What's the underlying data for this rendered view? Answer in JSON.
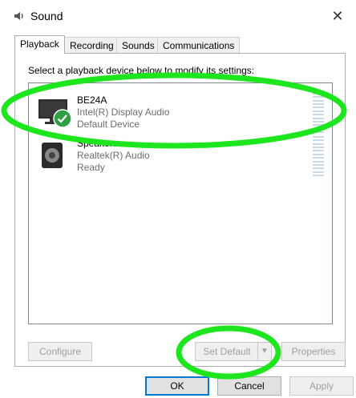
{
  "window": {
    "title": "Sound",
    "close_glyph": "✕",
    "icon": "speaker-icon"
  },
  "tabs": [
    {
      "label": "Playback",
      "active": true
    },
    {
      "label": "Recording",
      "active": false
    },
    {
      "label": "Sounds",
      "active": false
    },
    {
      "label": "Communications",
      "active": false
    }
  ],
  "instruction": "Select a playback device below to modify its settings:",
  "devices": [
    {
      "name": "BE24A",
      "driver": "Intel(R) Display Audio",
      "status": "Default Device",
      "icon": "monitor-icon",
      "badge": "check-badge-icon"
    },
    {
      "name": "Speakers",
      "driver": "Realtek(R) Audio",
      "status": "Ready",
      "icon": "speaker-icon"
    }
  ],
  "buttons": {
    "configure": "Configure",
    "set_default": "Set Default",
    "properties": "Properties",
    "ok": "OK",
    "cancel": "Cancel",
    "apply": "Apply"
  },
  "annotation_color": "#1ee61e",
  "colors": {
    "accent": "#0078d7",
    "check": "#2ea043",
    "disabled_text": "#a0a0a0"
  }
}
